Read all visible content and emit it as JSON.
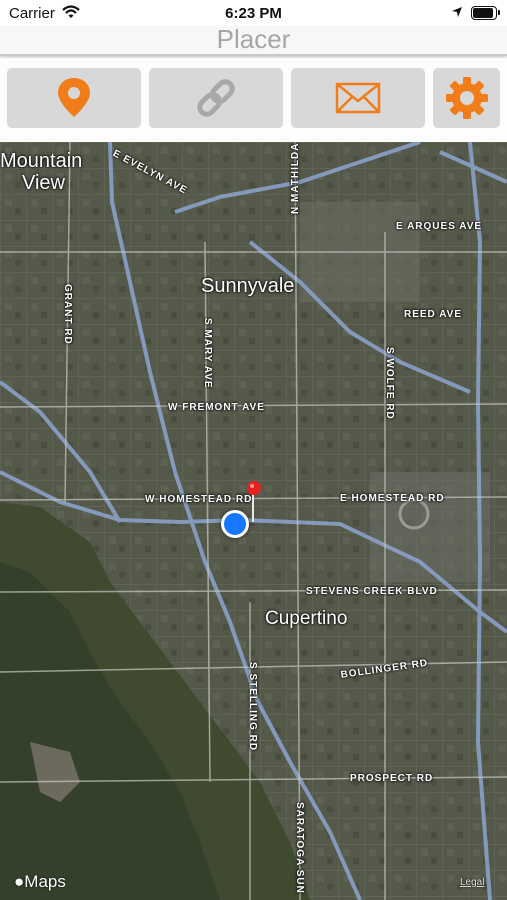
{
  "status_bar": {
    "carrier": "Carrier",
    "time": "6:23 PM"
  },
  "nav": {
    "title": "Placer"
  },
  "toolbar": {
    "buttons": [
      {
        "name": "location-pin-button",
        "icon": "map-pin-icon",
        "color": "#f07d1a"
      },
      {
        "name": "link-button",
        "icon": "link-icon",
        "color": "#a8a8a8"
      },
      {
        "name": "mail-button",
        "icon": "envelope-icon",
        "color": "#f07d1a"
      },
      {
        "name": "settings-button",
        "icon": "gear-icon",
        "color": "#f07d1a"
      }
    ]
  },
  "map": {
    "cities": [
      "Mountain",
      "View",
      "Sunnyvale",
      "Cupertino"
    ],
    "roads": {
      "evelyn": "E EVELYN AVE",
      "mathilda": "N MATHILDA",
      "arques": "E ARQUES AVE",
      "reed": "REED AVE",
      "grant": "GRANT RD",
      "mary": "S MARY AVE",
      "wolfe": "S WOLFE RD",
      "fremont": "W FREMONT AVE",
      "w_homestead": "W HOMESTEAD RD",
      "e_homestead": "E HOMESTEAD RD",
      "stevens_creek": "STEVENS CREEK BLVD",
      "bollinger": "BOLLINGER RD",
      "stelling": "S STELLING RD",
      "prospect": "PROSPECT RD",
      "saratoga": "SARATOGA SUN"
    },
    "branding": "Maps",
    "legal": "Legal"
  }
}
